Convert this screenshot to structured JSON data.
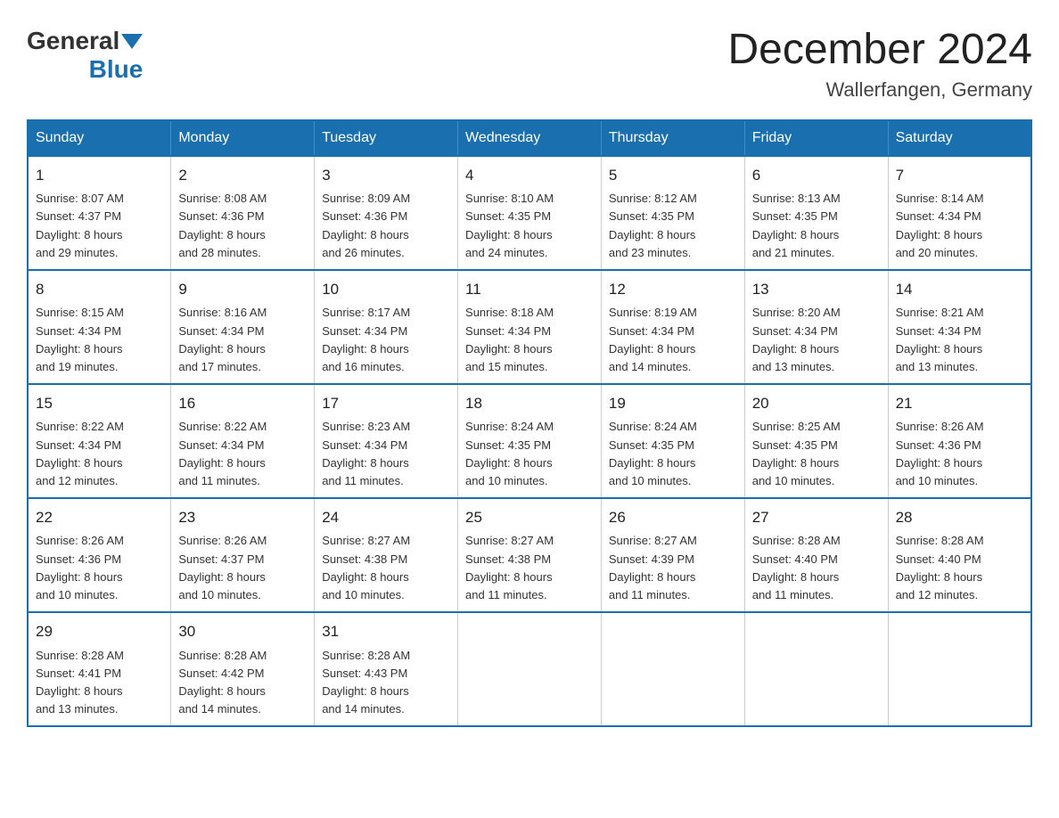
{
  "header": {
    "logo_general": "General",
    "logo_blue": "Blue",
    "month_title": "December 2024",
    "location": "Wallerfangen, Germany"
  },
  "days_of_week": [
    "Sunday",
    "Monday",
    "Tuesday",
    "Wednesday",
    "Thursday",
    "Friday",
    "Saturday"
  ],
  "weeks": [
    [
      {
        "day": "1",
        "sunrise": "8:07 AM",
        "sunset": "4:37 PM",
        "daylight": "8 hours and 29 minutes."
      },
      {
        "day": "2",
        "sunrise": "8:08 AM",
        "sunset": "4:36 PM",
        "daylight": "8 hours and 28 minutes."
      },
      {
        "day": "3",
        "sunrise": "8:09 AM",
        "sunset": "4:36 PM",
        "daylight": "8 hours and 26 minutes."
      },
      {
        "day": "4",
        "sunrise": "8:10 AM",
        "sunset": "4:35 PM",
        "daylight": "8 hours and 24 minutes."
      },
      {
        "day": "5",
        "sunrise": "8:12 AM",
        "sunset": "4:35 PM",
        "daylight": "8 hours and 23 minutes."
      },
      {
        "day": "6",
        "sunrise": "8:13 AM",
        "sunset": "4:35 PM",
        "daylight": "8 hours and 21 minutes."
      },
      {
        "day": "7",
        "sunrise": "8:14 AM",
        "sunset": "4:34 PM",
        "daylight": "8 hours and 20 minutes."
      }
    ],
    [
      {
        "day": "8",
        "sunrise": "8:15 AM",
        "sunset": "4:34 PM",
        "daylight": "8 hours and 19 minutes."
      },
      {
        "day": "9",
        "sunrise": "8:16 AM",
        "sunset": "4:34 PM",
        "daylight": "8 hours and 17 minutes."
      },
      {
        "day": "10",
        "sunrise": "8:17 AM",
        "sunset": "4:34 PM",
        "daylight": "8 hours and 16 minutes."
      },
      {
        "day": "11",
        "sunrise": "8:18 AM",
        "sunset": "4:34 PM",
        "daylight": "8 hours and 15 minutes."
      },
      {
        "day": "12",
        "sunrise": "8:19 AM",
        "sunset": "4:34 PM",
        "daylight": "8 hours and 14 minutes."
      },
      {
        "day": "13",
        "sunrise": "8:20 AM",
        "sunset": "4:34 PM",
        "daylight": "8 hours and 13 minutes."
      },
      {
        "day": "14",
        "sunrise": "8:21 AM",
        "sunset": "4:34 PM",
        "daylight": "8 hours and 13 minutes."
      }
    ],
    [
      {
        "day": "15",
        "sunrise": "8:22 AM",
        "sunset": "4:34 PM",
        "daylight": "8 hours and 12 minutes."
      },
      {
        "day": "16",
        "sunrise": "8:22 AM",
        "sunset": "4:34 PM",
        "daylight": "8 hours and 11 minutes."
      },
      {
        "day": "17",
        "sunrise": "8:23 AM",
        "sunset": "4:34 PM",
        "daylight": "8 hours and 11 minutes."
      },
      {
        "day": "18",
        "sunrise": "8:24 AM",
        "sunset": "4:35 PM",
        "daylight": "8 hours and 10 minutes."
      },
      {
        "day": "19",
        "sunrise": "8:24 AM",
        "sunset": "4:35 PM",
        "daylight": "8 hours and 10 minutes."
      },
      {
        "day": "20",
        "sunrise": "8:25 AM",
        "sunset": "4:35 PM",
        "daylight": "8 hours and 10 minutes."
      },
      {
        "day": "21",
        "sunrise": "8:26 AM",
        "sunset": "4:36 PM",
        "daylight": "8 hours and 10 minutes."
      }
    ],
    [
      {
        "day": "22",
        "sunrise": "8:26 AM",
        "sunset": "4:36 PM",
        "daylight": "8 hours and 10 minutes."
      },
      {
        "day": "23",
        "sunrise": "8:26 AM",
        "sunset": "4:37 PM",
        "daylight": "8 hours and 10 minutes."
      },
      {
        "day": "24",
        "sunrise": "8:27 AM",
        "sunset": "4:38 PM",
        "daylight": "8 hours and 10 minutes."
      },
      {
        "day": "25",
        "sunrise": "8:27 AM",
        "sunset": "4:38 PM",
        "daylight": "8 hours and 11 minutes."
      },
      {
        "day": "26",
        "sunrise": "8:27 AM",
        "sunset": "4:39 PM",
        "daylight": "8 hours and 11 minutes."
      },
      {
        "day": "27",
        "sunrise": "8:28 AM",
        "sunset": "4:40 PM",
        "daylight": "8 hours and 11 minutes."
      },
      {
        "day": "28",
        "sunrise": "8:28 AM",
        "sunset": "4:40 PM",
        "daylight": "8 hours and 12 minutes."
      }
    ],
    [
      {
        "day": "29",
        "sunrise": "8:28 AM",
        "sunset": "4:41 PM",
        "daylight": "8 hours and 13 minutes."
      },
      {
        "day": "30",
        "sunrise": "8:28 AM",
        "sunset": "4:42 PM",
        "daylight": "8 hours and 14 minutes."
      },
      {
        "day": "31",
        "sunrise": "8:28 AM",
        "sunset": "4:43 PM",
        "daylight": "8 hours and 14 minutes."
      },
      null,
      null,
      null,
      null
    ]
  ],
  "labels": {
    "sunrise": "Sunrise:",
    "sunset": "Sunset:",
    "daylight": "Daylight:"
  }
}
